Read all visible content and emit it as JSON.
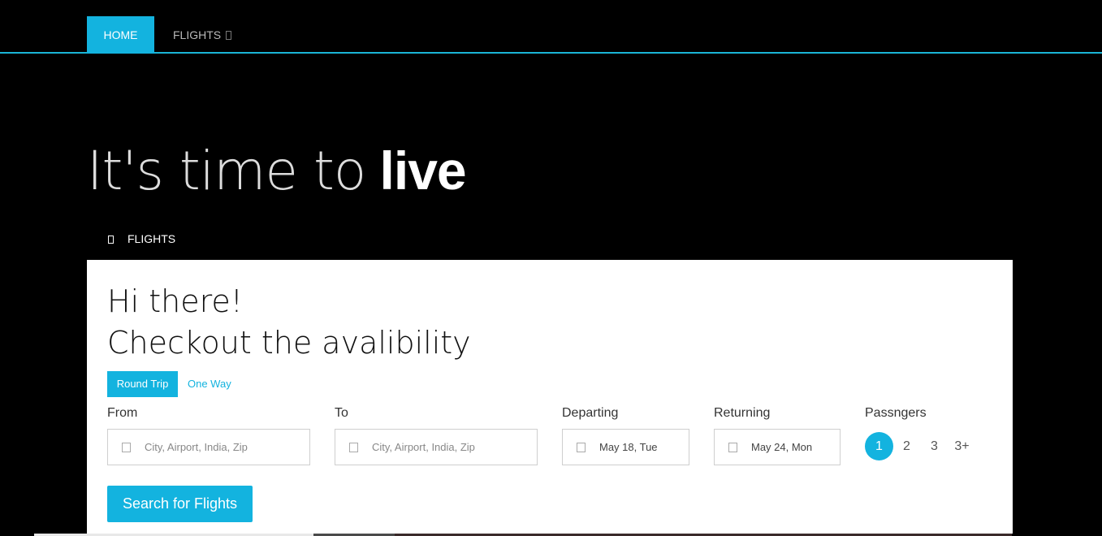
{
  "nav": {
    "home_label": "HOME",
    "flights_label": "FLIGHTS",
    "accent": "#13b3df"
  },
  "hero": {
    "light_text": "It's time to",
    "bold_text": "live"
  },
  "tab": {
    "label": "FLIGHTS",
    "icon": "plane-icon"
  },
  "panel": {
    "greeting_line1": "Hi there!",
    "greeting_line2": "Checkout the avalibility",
    "trip_types": {
      "round_trip": "Round Trip",
      "one_way": "One Way"
    },
    "from": {
      "label": "From",
      "placeholder": "City, Airport, India, Zip"
    },
    "to": {
      "label": "To",
      "placeholder": "City, Airport, India, Zip"
    },
    "departing": {
      "label": "Departing",
      "value": "May 18, Tue"
    },
    "returning": {
      "label": "Returning",
      "value": "May 24, Mon"
    },
    "passengers": {
      "label": "Passngers",
      "options": [
        "1",
        "2",
        "3",
        "3+"
      ],
      "selected": "1"
    },
    "search_button": "Search for Flights"
  }
}
